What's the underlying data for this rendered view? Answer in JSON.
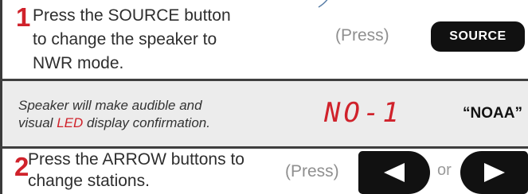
{
  "step1": {
    "number": "1",
    "text_before": "Press the ",
    "text_highlight": "SOURCE",
    "text_after_line1": " button",
    "line2": "to change the speaker to",
    "line3": "NWR mode.",
    "press_label": "(Press)",
    "button_label": "SOURCE"
  },
  "confirmation": {
    "text_line1": "Speaker will make audible and",
    "text_line2_before": "visual ",
    "text_line2_highlight": "LED",
    "text_line2_after": " display confirmation.",
    "lcd_display": "NO-1",
    "announcement": "“NOAA”"
  },
  "step2": {
    "number": "2",
    "text_before": " Press the ",
    "text_highlight": "ARROW",
    "text_after_line1": " buttons to",
    "line2": "change stations.",
    "press_label": "(Press)",
    "or_label": "or"
  },
  "icons": {
    "left": "arrow-left-icon",
    "right": "arrow-right-icon"
  },
  "colors": {
    "accent": "#d0222b",
    "button": "#111111",
    "panel": "#ececec"
  }
}
